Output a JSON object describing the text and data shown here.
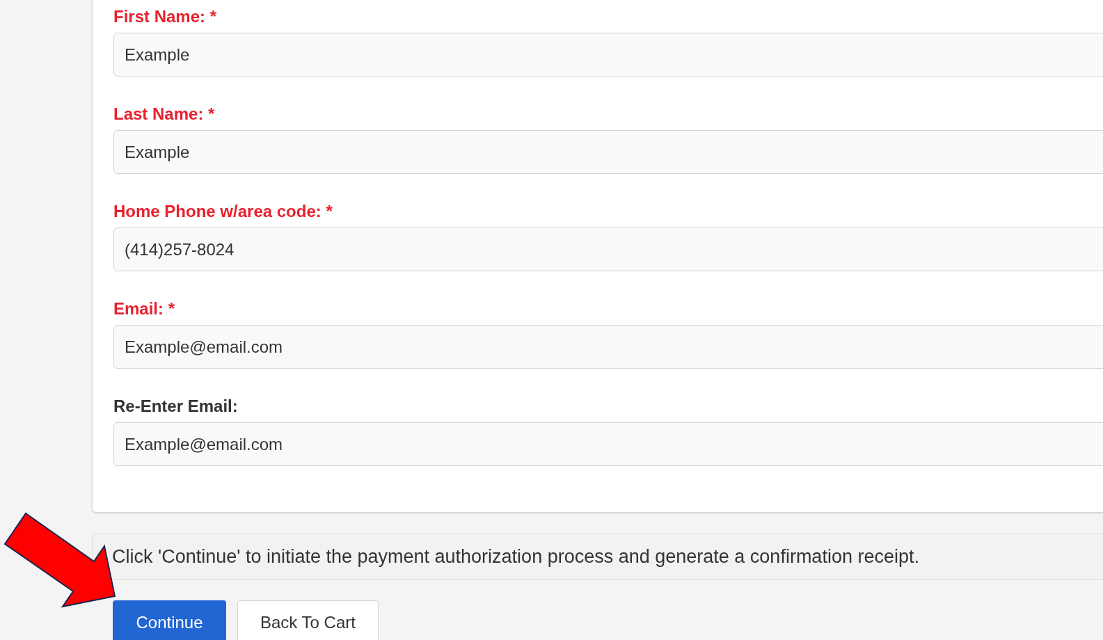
{
  "fields": [
    {
      "label": "First Name: *",
      "value": "Example",
      "required": true
    },
    {
      "label": "Last Name: *",
      "value": "Example",
      "required": true
    },
    {
      "label": "Home Phone w/area code: *",
      "value": "(414)257-8024",
      "required": true
    },
    {
      "label": "Email: *",
      "value": "Example@email.com",
      "required": true
    },
    {
      "label": "Re-Enter Email:",
      "value": "Example@email.com",
      "required": false
    }
  ],
  "note": "Click 'Continue' to initiate the payment authorization process and generate a confirmation receipt.",
  "buttons": [
    {
      "label": "Continue",
      "kind": "primary"
    },
    {
      "label": "Back To Cart",
      "kind": "secondary"
    }
  ]
}
